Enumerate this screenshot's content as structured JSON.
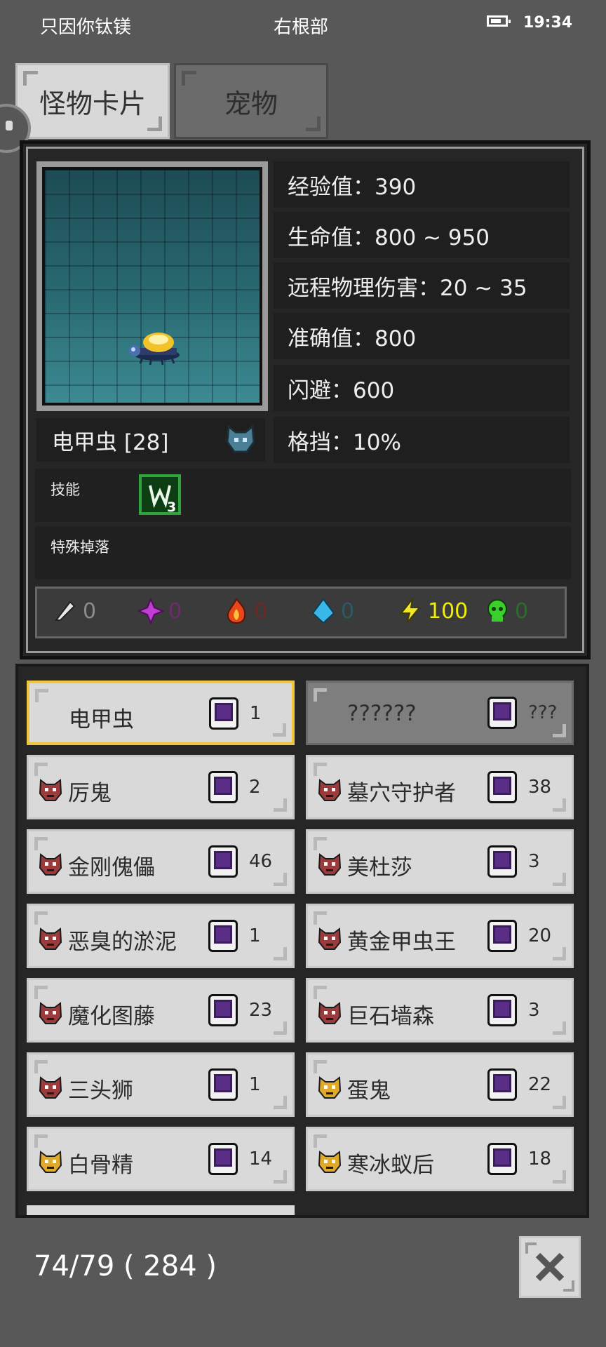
{
  "status_bar": {
    "left_text": "只因你钛镁",
    "center_text": "右根部",
    "time": "19:34"
  },
  "tabs": [
    {
      "label": "怪物卡片",
      "active": true
    },
    {
      "label": "宠物",
      "active": false
    }
  ],
  "monster": {
    "name": "电甲虫 [28]",
    "stats": [
      "经验值：390",
      "生命值：800 ~ 950",
      "远程物理伤害：20 ~ 35",
      "准确值：800",
      "闪避：600",
      "格挡：10%"
    ],
    "skill_label": "技能",
    "skill_count": "3",
    "drop_label": "特殊掉落",
    "resistances": [
      {
        "icon": "physical-icon",
        "value": "0",
        "color": "#8c8c8c"
      },
      {
        "icon": "arcane-icon",
        "value": "0",
        "color": "#6a2d6a"
      },
      {
        "icon": "fire-icon",
        "value": "0",
        "color": "#6a2a2a"
      },
      {
        "icon": "water-icon",
        "value": "0",
        "color": "#2a5a66"
      },
      {
        "icon": "lightning-icon",
        "value": "100",
        "color": "#f0f000"
      },
      {
        "icon": "poison-icon",
        "value": "0",
        "color": "#2f6a2f"
      }
    ]
  },
  "monster_list": [
    {
      "name": "电甲虫",
      "count": "1",
      "state": "selected"
    },
    {
      "name": "??????",
      "count": "???",
      "state": "unknown"
    },
    {
      "name": "厉鬼",
      "count": "2",
      "state": "normal",
      "badge": "red"
    },
    {
      "name": "墓穴守护者",
      "count": "38",
      "state": "normal",
      "badge": "red"
    },
    {
      "name": "金刚傀儡",
      "count": "46",
      "state": "normal",
      "badge": "red"
    },
    {
      "name": "美杜莎",
      "count": "3",
      "state": "normal",
      "badge": "red"
    },
    {
      "name": "恶臭的淤泥",
      "count": "1",
      "state": "normal",
      "badge": "red"
    },
    {
      "name": "黄金甲虫王",
      "count": "20",
      "state": "normal",
      "badge": "red"
    },
    {
      "name": "魔化图藤",
      "count": "23",
      "state": "normal",
      "badge": "red"
    },
    {
      "name": "巨石墙森",
      "count": "3",
      "state": "normal",
      "badge": "red"
    },
    {
      "name": "三头狮",
      "count": "1",
      "state": "normal",
      "badge": "red"
    },
    {
      "name": "蛋鬼",
      "count": "22",
      "state": "normal",
      "badge": "gold"
    },
    {
      "name": "白骨精",
      "count": "14",
      "state": "normal",
      "badge": "gold"
    },
    {
      "name": "寒冰蚁后",
      "count": "18",
      "state": "normal",
      "badge": "gold"
    }
  ],
  "footer": {
    "collection_count": "74/79 ( 284 )"
  }
}
